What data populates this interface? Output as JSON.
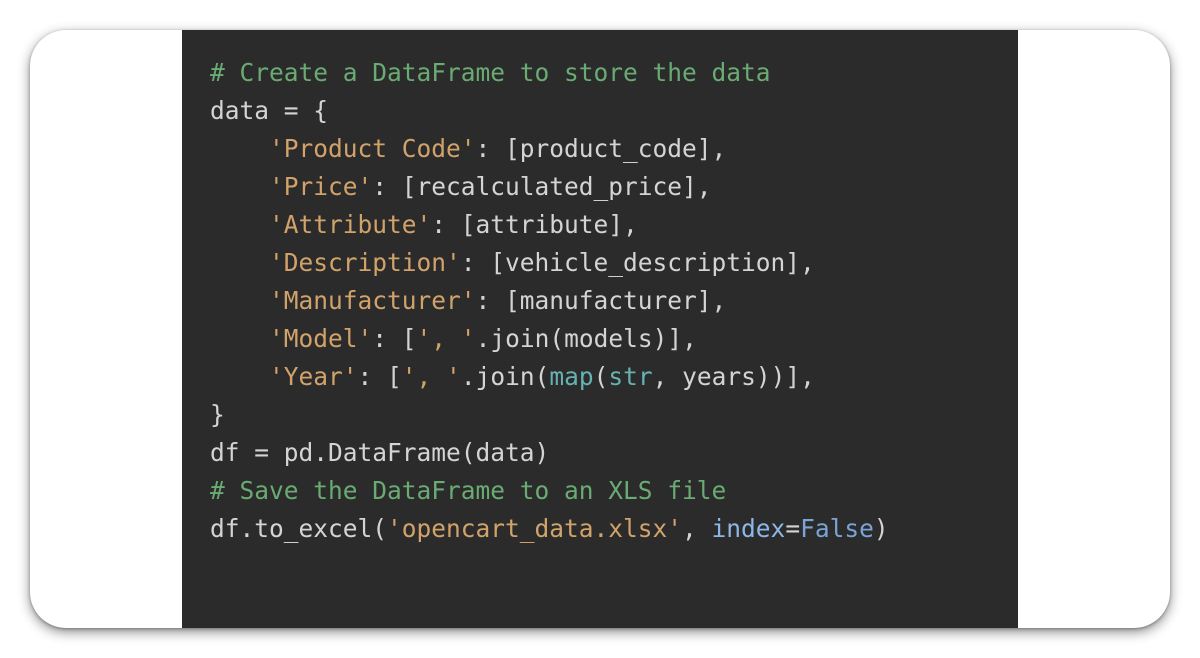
{
  "code": {
    "comment1": "# Create a DataFrame to store the data",
    "line_data_open": "data = {",
    "key_product_code": "'Product Code'",
    "val_product_code": ": [product_code],",
    "key_price": "'Price'",
    "val_price": ": [recalculated_price],",
    "key_attribute": "'Attribute'",
    "val_attribute": ": [attribute],",
    "key_description": "'Description'",
    "val_description": ": [vehicle_description],",
    "key_manufacturer": "'Manufacturer'",
    "val_manufacturer": ": [manufacturer],",
    "key_model": "'Model'",
    "model_before": ": [",
    "model_joinstr": "', '",
    "model_join": ".join(models)],",
    "key_year": "'Year'",
    "year_before": ": [",
    "year_joinstr": "', '",
    "year_join_open": ".join(",
    "map_name": "map",
    "map_open": "(",
    "str_name": "str",
    "map_rest": ", years))],",
    "brace_close": "}",
    "df_line": "df = pd.DataFrame(data)",
    "comment2": "# Save the DataFrame to an XLS file",
    "excel_prefix": "df.to_excel(",
    "excel_file": "'opencart_data.xlsx'",
    "excel_mid": ", ",
    "index_kw": "index",
    "excel_eq": "=",
    "false_kw": "False",
    "excel_close": ")"
  }
}
